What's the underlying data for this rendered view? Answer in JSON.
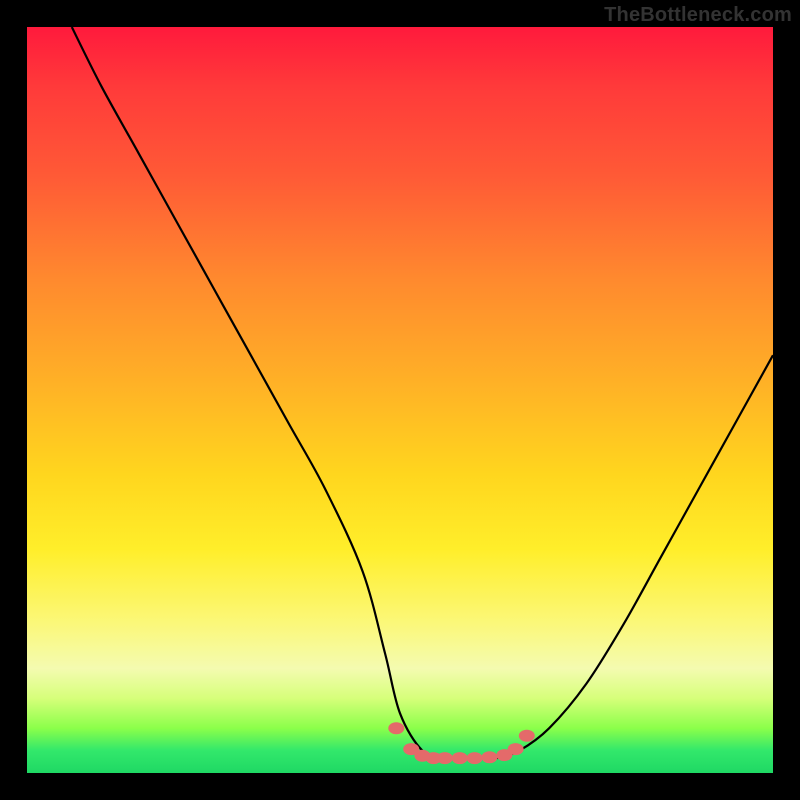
{
  "watermark": "TheBottleneck.com",
  "colors": {
    "page_bg": "#000000",
    "curve_stroke": "#000000",
    "marker_fill": "#e46a6a",
    "gradient_stops": [
      "#ff1a3c",
      "#ff3a3a",
      "#ff5a36",
      "#ff8a2e",
      "#ffb226",
      "#ffd61e",
      "#ffee2a",
      "#fbf87a",
      "#f4fbb0",
      "#d6ff7a",
      "#8bff4a",
      "#32e86b",
      "#1fd864"
    ]
  },
  "chart_data": {
    "type": "line",
    "title": "",
    "xlabel": "",
    "ylabel": "",
    "xlim": [
      0,
      100
    ],
    "ylim": [
      0,
      100
    ],
    "series": [
      {
        "name": "bottleneck-curve",
        "x": [
          6,
          10,
          15,
          20,
          25,
          30,
          35,
          40,
          45,
          48,
          50,
          53,
          56,
          60,
          63,
          66,
          70,
          75,
          80,
          85,
          90,
          95,
          100
        ],
        "y": [
          100,
          92,
          83,
          74,
          65,
          56,
          47,
          38,
          27,
          16,
          8,
          3,
          2,
          2,
          2,
          3,
          6,
          12,
          20,
          29,
          38,
          47,
          56
        ]
      }
    ],
    "markers": {
      "name": "valley-markers",
      "symbol": "blob",
      "color": "#e46a6a",
      "x": [
        49.5,
        51.5,
        53,
        54.5,
        56,
        58,
        60,
        62,
        64,
        65.5,
        67
      ],
      "y": [
        6.0,
        3.2,
        2.3,
        2.0,
        2.0,
        2.0,
        2.0,
        2.1,
        2.4,
        3.2,
        5.0
      ]
    }
  }
}
